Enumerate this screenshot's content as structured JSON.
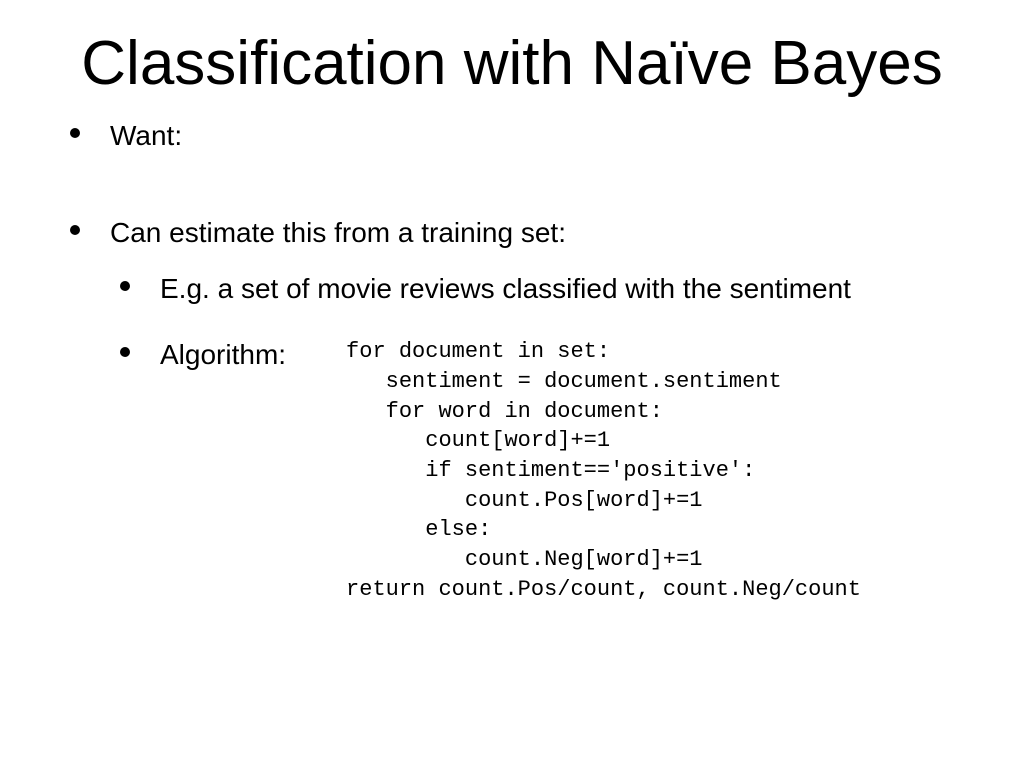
{
  "title": "Classification with Naïve Bayes",
  "bullets": {
    "want": "Want:",
    "estimate": "Can estimate this from a training set:",
    "example": "E.g. a set of movie reviews classified with the sentiment",
    "algorithm_label": "Algorithm:"
  },
  "code": "for document in set:\n   sentiment = document.sentiment\n   for word in document:\n      count[word]+=1\n      if sentiment=='positive':\n         count.Pos[word]+=1\n      else:\n         count.Neg[word]+=1\nreturn count.Pos/count, count.Neg/count"
}
